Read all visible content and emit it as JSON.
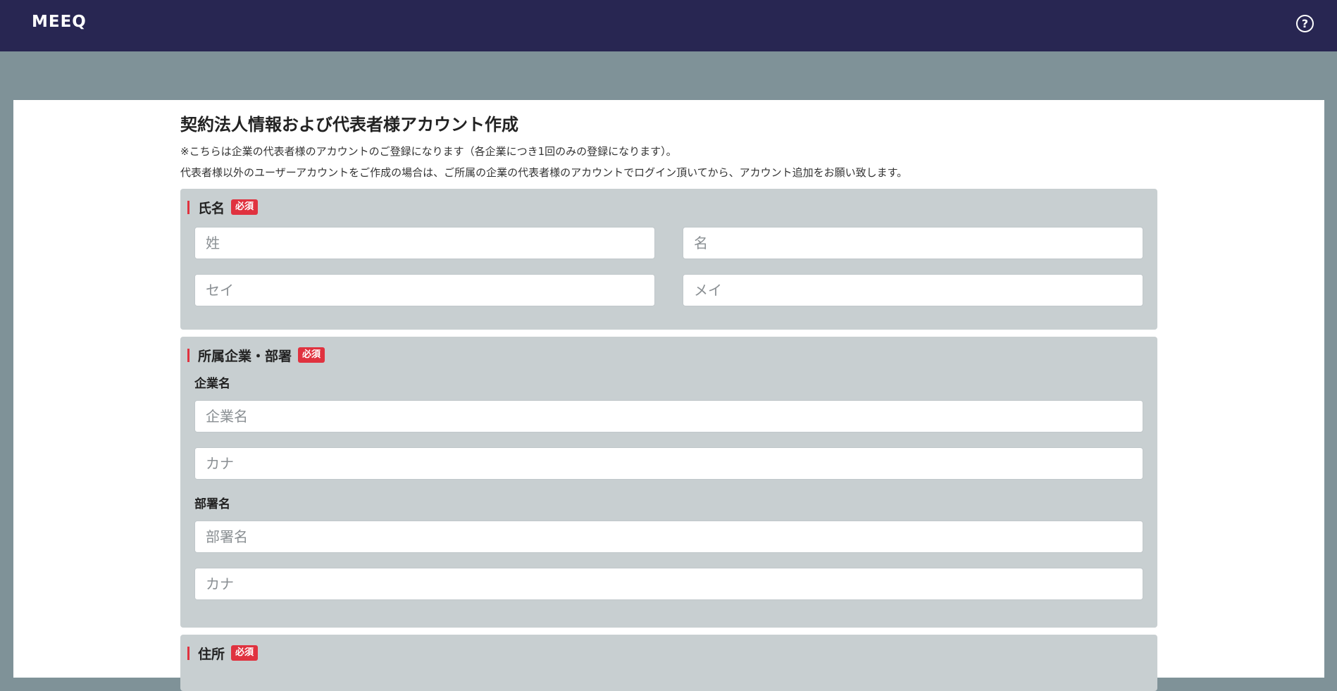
{
  "header": {
    "logo": "MEEQ",
    "help_icon": "?"
  },
  "page": {
    "title": "契約法人情報および代表者様アカウント作成",
    "note1": "※こちらは企業の代表者様のアカウントのご登録になります（各企業につき1回のみの登録になります）。",
    "note2": "代表者様以外のユーザーアカウントをご作成の場合は、ご所属の企業の代表者様のアカウントでログイン頂いてから、アカウント追加をお願い致します。"
  },
  "sections": {
    "name": {
      "title": "氏名",
      "required": "必須",
      "last_name_placeholder": "姓",
      "first_name_placeholder": "名",
      "last_kana_placeholder": "セイ",
      "first_kana_placeholder": "メイ"
    },
    "company": {
      "title": "所属企業・部署",
      "required": "必須",
      "company_label": "企業名",
      "company_placeholder": "企業名",
      "company_kana_placeholder": "カナ",
      "dept_label": "部署名",
      "dept_placeholder": "部署名",
      "dept_kana_placeholder": "カナ"
    },
    "address": {
      "title": "住所",
      "required": "必須"
    }
  }
}
